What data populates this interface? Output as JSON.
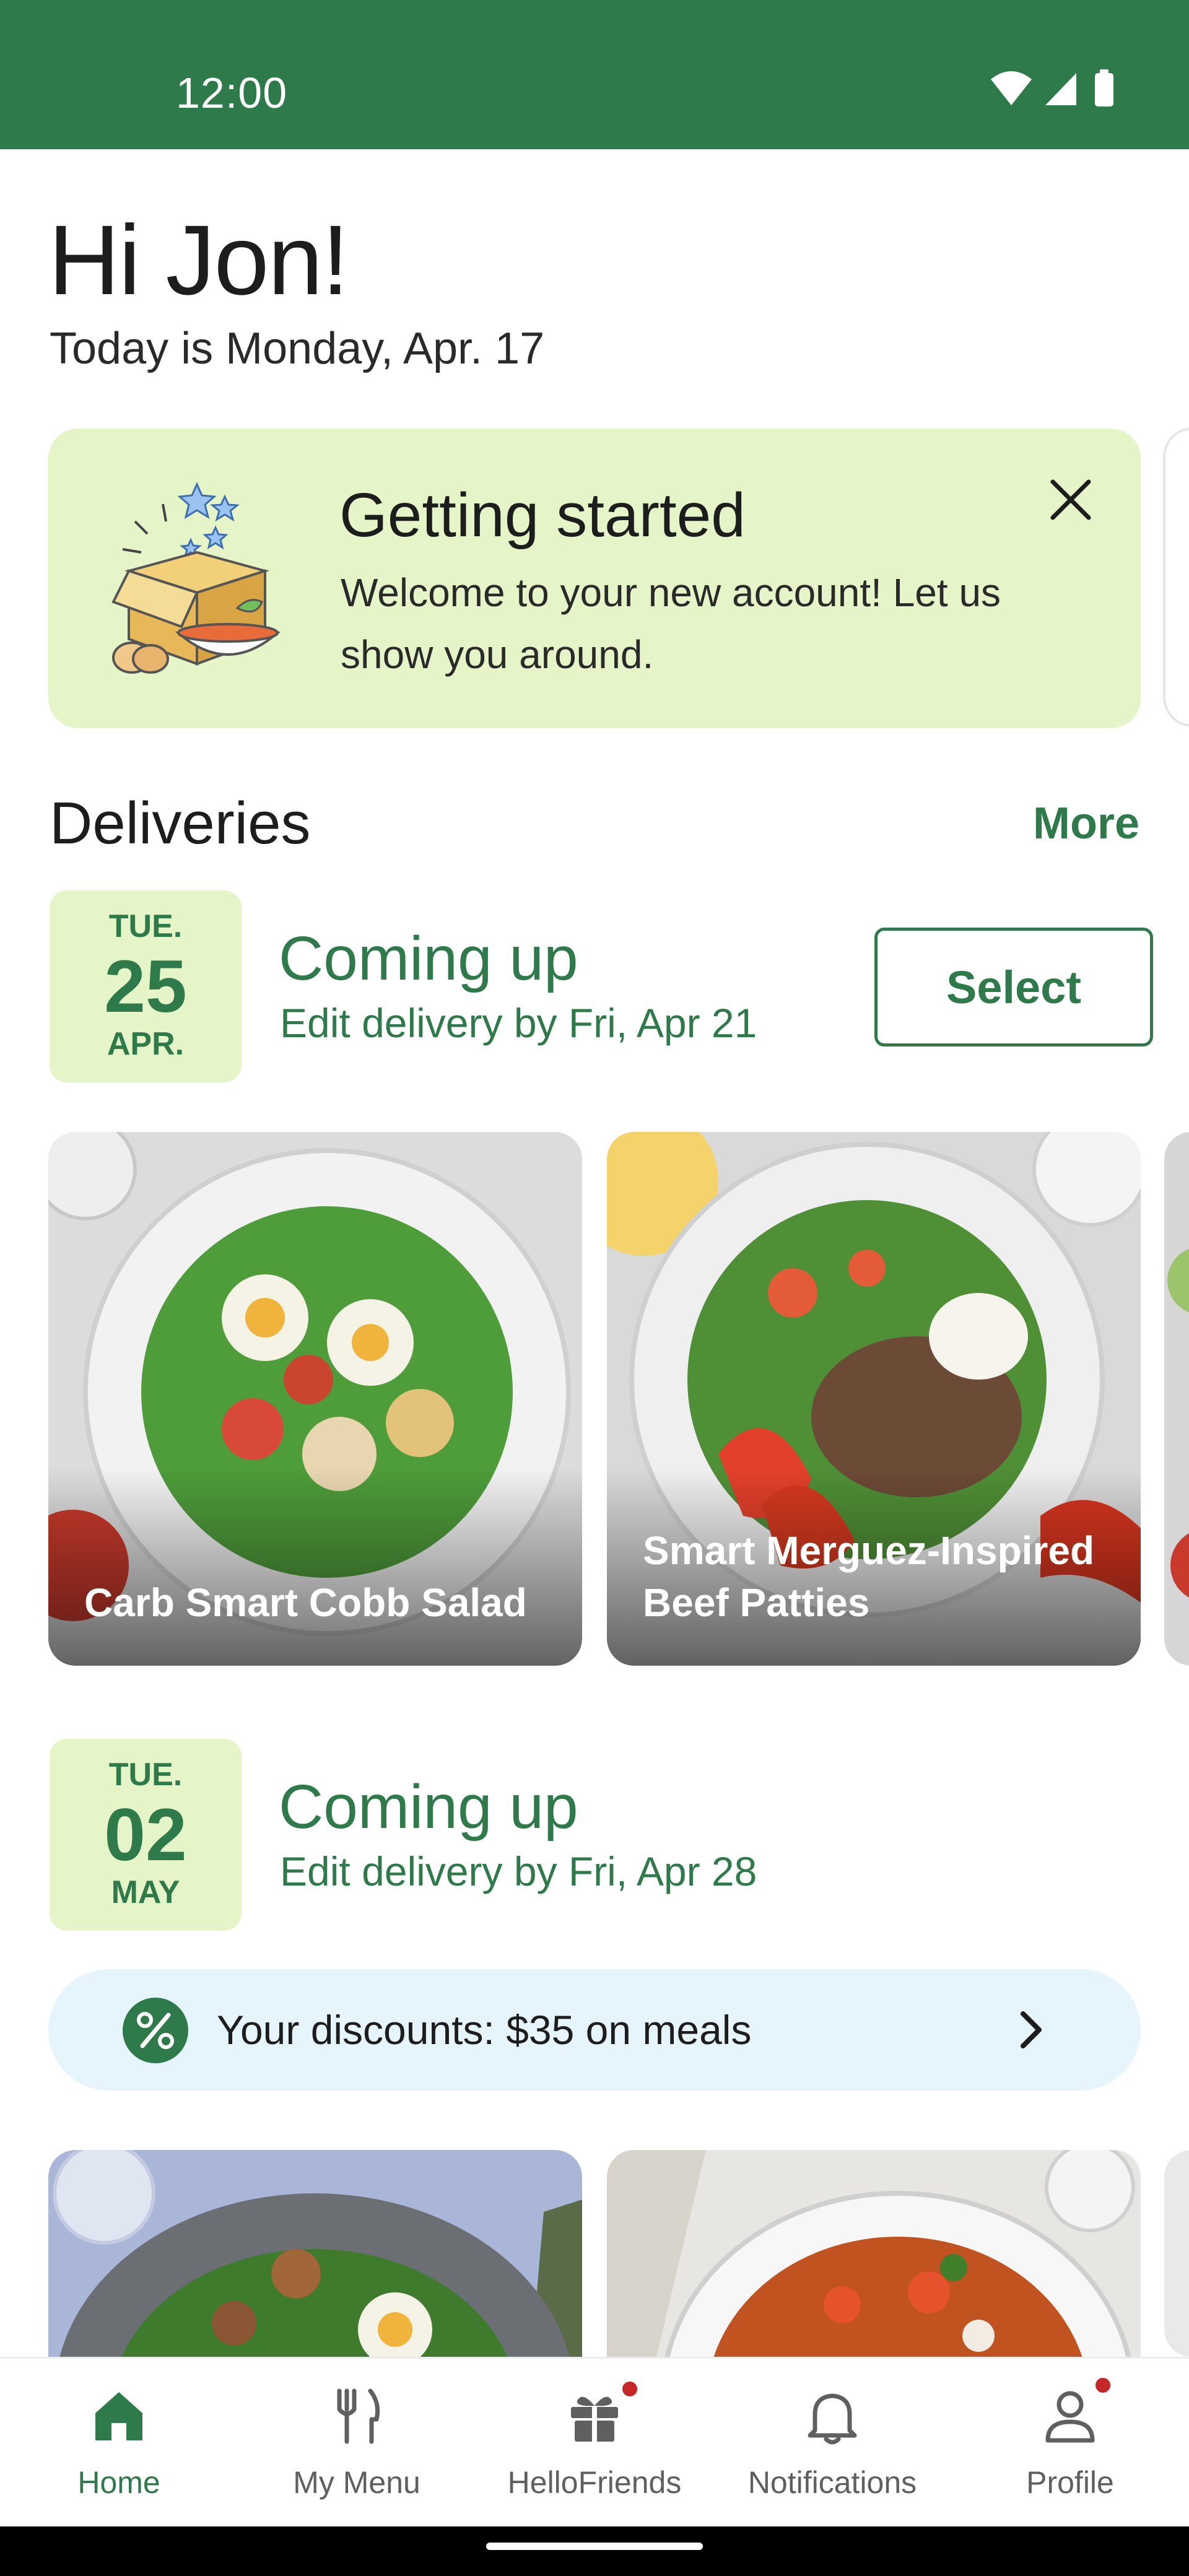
{
  "status_bar": {
    "time": "12:00",
    "background": "#2f7a4b"
  },
  "greeting": {
    "title": "Hi Jon!",
    "date": "Today is Monday, Apr. 17"
  },
  "getting_started": {
    "title": "Getting started",
    "body": "Welcome to your new account! Let us show you around.",
    "close_icon": "close-icon",
    "background": "#e5f5c7"
  },
  "deliveries": {
    "title": "Deliveries",
    "more_label": "More",
    "items": [
      {
        "dow": "TUE.",
        "day": "25",
        "month": "APR.",
        "status": "Coming up",
        "edit_by": "Edit delivery by Fri, Apr 21",
        "action_label": "Select",
        "meals": [
          {
            "name": "Carb Smart Cobb Salad"
          },
          {
            "name": "Smart Merguez-Inspired Beef Patties"
          }
        ]
      },
      {
        "dow": "TUE.",
        "day": "02",
        "month": "MAY",
        "status": "Coming up",
        "edit_by": "Edit delivery by Fri, Apr 28",
        "discount": {
          "text": "Your discounts: $35 on meals",
          "icon": "percent-icon"
        }
      }
    ]
  },
  "bottom_nav": {
    "items": [
      {
        "label": "Home",
        "icon": "home-icon",
        "active": true
      },
      {
        "label": "My Menu",
        "icon": "fork-knife-icon",
        "active": false
      },
      {
        "label": "HelloFriends",
        "icon": "gift-icon",
        "active": false,
        "badge": true
      },
      {
        "label": "Notifications",
        "icon": "bell-icon",
        "active": false
      },
      {
        "label": "Profile",
        "icon": "person-icon",
        "active": false,
        "badge": true
      }
    ]
  },
  "colors": {
    "brand_green": "#2f7a4b",
    "light_green": "#e5f5c7",
    "light_blue": "#e6f4fb",
    "badge_red": "#c62828"
  }
}
